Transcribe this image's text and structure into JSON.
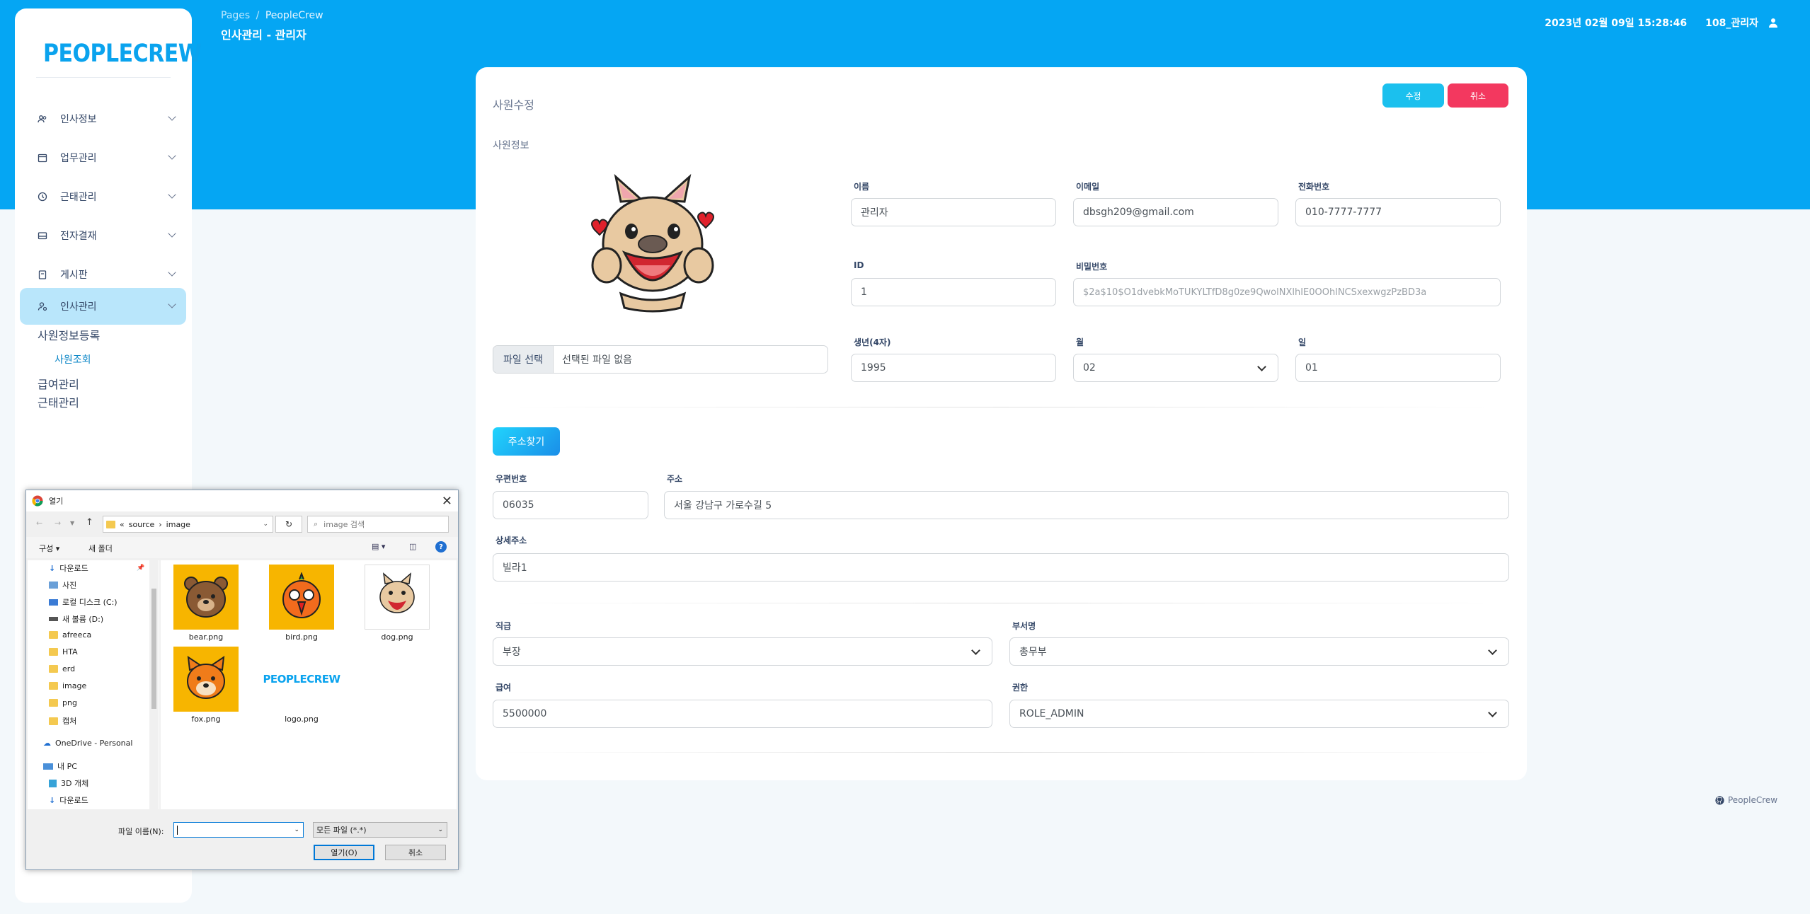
{
  "sidebar": {
    "logo": "PEOPLECREW",
    "items": [
      {
        "label": "인사정보"
      },
      {
        "label": "업무관리"
      },
      {
        "label": "근태관리"
      },
      {
        "label": "전자결재"
      },
      {
        "label": "게시판"
      },
      {
        "label": "인사관리"
      }
    ],
    "sub_links": [
      "사원정보등록",
      "사원조회",
      "급여관리",
      "근태관리"
    ]
  },
  "header": {
    "breadcrumb_pages": "Pages",
    "breadcrumb_sep": "/",
    "breadcrumb_current": "PeopleCrew",
    "page_title": "인사관리 - 관리자",
    "datetime": "2023년 02월 09일  15:28:46",
    "user": "108_관리자"
  },
  "card": {
    "title": "사원수정",
    "save_button": "수정",
    "cancel_button": "취소",
    "section_title": "사원정보",
    "file_button": "파일 선택",
    "file_status": "선택된 파일 없음",
    "fields": {
      "name": {
        "label": "이름",
        "value": "관리자"
      },
      "email": {
        "label": "이메일",
        "value": "dbsgh209@gmail.com"
      },
      "phone": {
        "label": "전화번호",
        "value": "010-7777-7777"
      },
      "id": {
        "label": "ID",
        "value": "1"
      },
      "password": {
        "label": "비밀번호",
        "value": "$2a$10$O1dvebkMoTUKYLTfD8g0ze9QwolNXlhIE0OOhlNCSxexwgzPzBD3a"
      },
      "birth_year": {
        "label": "생년(4자)",
        "value": "1995"
      },
      "month": {
        "label": "월",
        "value": "02"
      },
      "day": {
        "label": "일",
        "value": "01"
      },
      "zipcode": {
        "label": "우편번호",
        "value": "06035"
      },
      "address": {
        "label": "주소",
        "value": "서울 강남구 가로수길 5"
      },
      "detail_address": {
        "label": "상세주소",
        "value": "빌라1"
      },
      "position": {
        "label": "직급",
        "value": "부장"
      },
      "department": {
        "label": "부서명",
        "value": "총무부"
      },
      "salary": {
        "label": "급여",
        "value": "5500000"
      },
      "role": {
        "label": "권한",
        "value": "ROLE_ADMIN"
      }
    },
    "address_button": "주소찾기"
  },
  "footer": {
    "text": "PeopleCrew"
  },
  "file_dialog": {
    "title": "열기",
    "path": [
      "«",
      "source",
      "›",
      "image"
    ],
    "search_placeholder": "image 검색",
    "organize": "구성 ▾",
    "new_folder": "새 폴더",
    "tree": [
      "다운로드",
      "사진",
      "로컬 디스크 (C:)",
      "새 볼륨 (D:)",
      "afreeca",
      "HTA",
      "erd",
      "image",
      "png",
      "캡처",
      "OneDrive - Personal",
      "내 PC",
      "3D 개체",
      "다운로드"
    ],
    "files": [
      "bear.png",
      "bird.png",
      "dog.png",
      "fox.png",
      "logo.png"
    ],
    "logo_text": "PEOPLECREW",
    "filename_label": "파일 이름(N):",
    "filetype": "모든 파일 (*.*)",
    "open_button": "열기(O)",
    "cancel_button": "취소"
  }
}
